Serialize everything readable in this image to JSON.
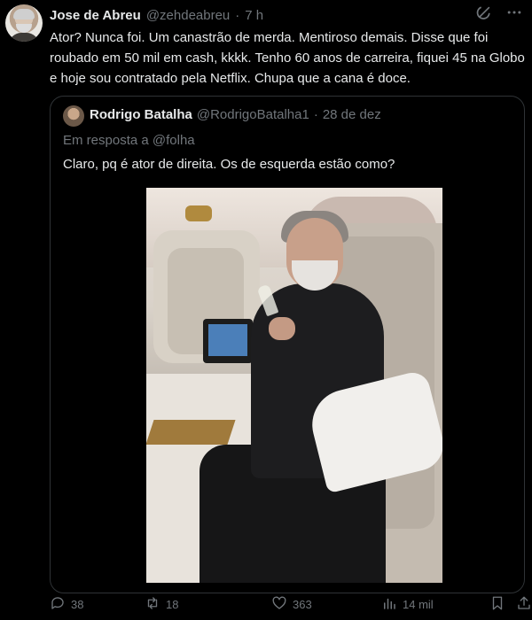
{
  "author": {
    "name": "Jose de Abreu",
    "handle": "@zehdeabreu",
    "separator": "·",
    "time": "7 h"
  },
  "text": "Ator? Nunca foi. Um canastrão de merda. Mentiroso demais. Disse que foi roubado em 50 mil em cash, kkkk. Tenho 60 anos de carreira, fiquei 45 na Globo e hoje sou contratado pela Netflix. Chupa que a cana é doce.",
  "quoted": {
    "name": "Rodrigo Batalha",
    "handle": "@RodrigoBatalha1",
    "separator": "·",
    "date": "28 de dez",
    "reply_to": "Em resposta a @folha",
    "text": "Claro, pq é ator de direita. Os de esquerda estão como?"
  },
  "actions": {
    "replies": "38",
    "retweets": "18",
    "likes": "363",
    "views": "14 mil"
  },
  "colors": {
    "background": "#000000",
    "text": "#e7e9ea",
    "muted": "#71767b",
    "border": "#2f3336"
  },
  "icons": [
    "grok-icon",
    "more-icon",
    "reply-icon",
    "retweet-icon",
    "like-icon",
    "views-icon",
    "bookmark-icon",
    "share-icon"
  ]
}
